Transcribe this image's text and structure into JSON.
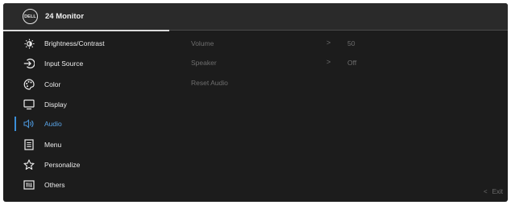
{
  "header": {
    "logo_text": "DELL",
    "title": "24 Monitor"
  },
  "menu": {
    "items": [
      {
        "label": "Brightness/Contrast",
        "icon": "brightness-icon"
      },
      {
        "label": "Input Source",
        "icon": "input-source-icon"
      },
      {
        "label": "Color",
        "icon": "color-palette-icon"
      },
      {
        "label": "Display",
        "icon": "display-icon"
      },
      {
        "label": "Audio",
        "icon": "speaker-icon",
        "active": true
      },
      {
        "label": "Menu",
        "icon": "menu-icon"
      },
      {
        "label": "Personalize",
        "icon": "star-icon"
      },
      {
        "label": "Others",
        "icon": "others-icon"
      }
    ]
  },
  "audio": {
    "rows": [
      {
        "label": "Volume",
        "chevron": ">",
        "value": "50"
      },
      {
        "label": "Speaker",
        "chevron": ">",
        "value": "Off"
      },
      {
        "label": "Reset Audio"
      }
    ]
  },
  "footer": {
    "exit_chevron": "<",
    "exit_label": "Exit"
  },
  "colors": {
    "accent": "#3b8fd9",
    "background": "#1c1c1c",
    "header": "#2a2a2a"
  }
}
